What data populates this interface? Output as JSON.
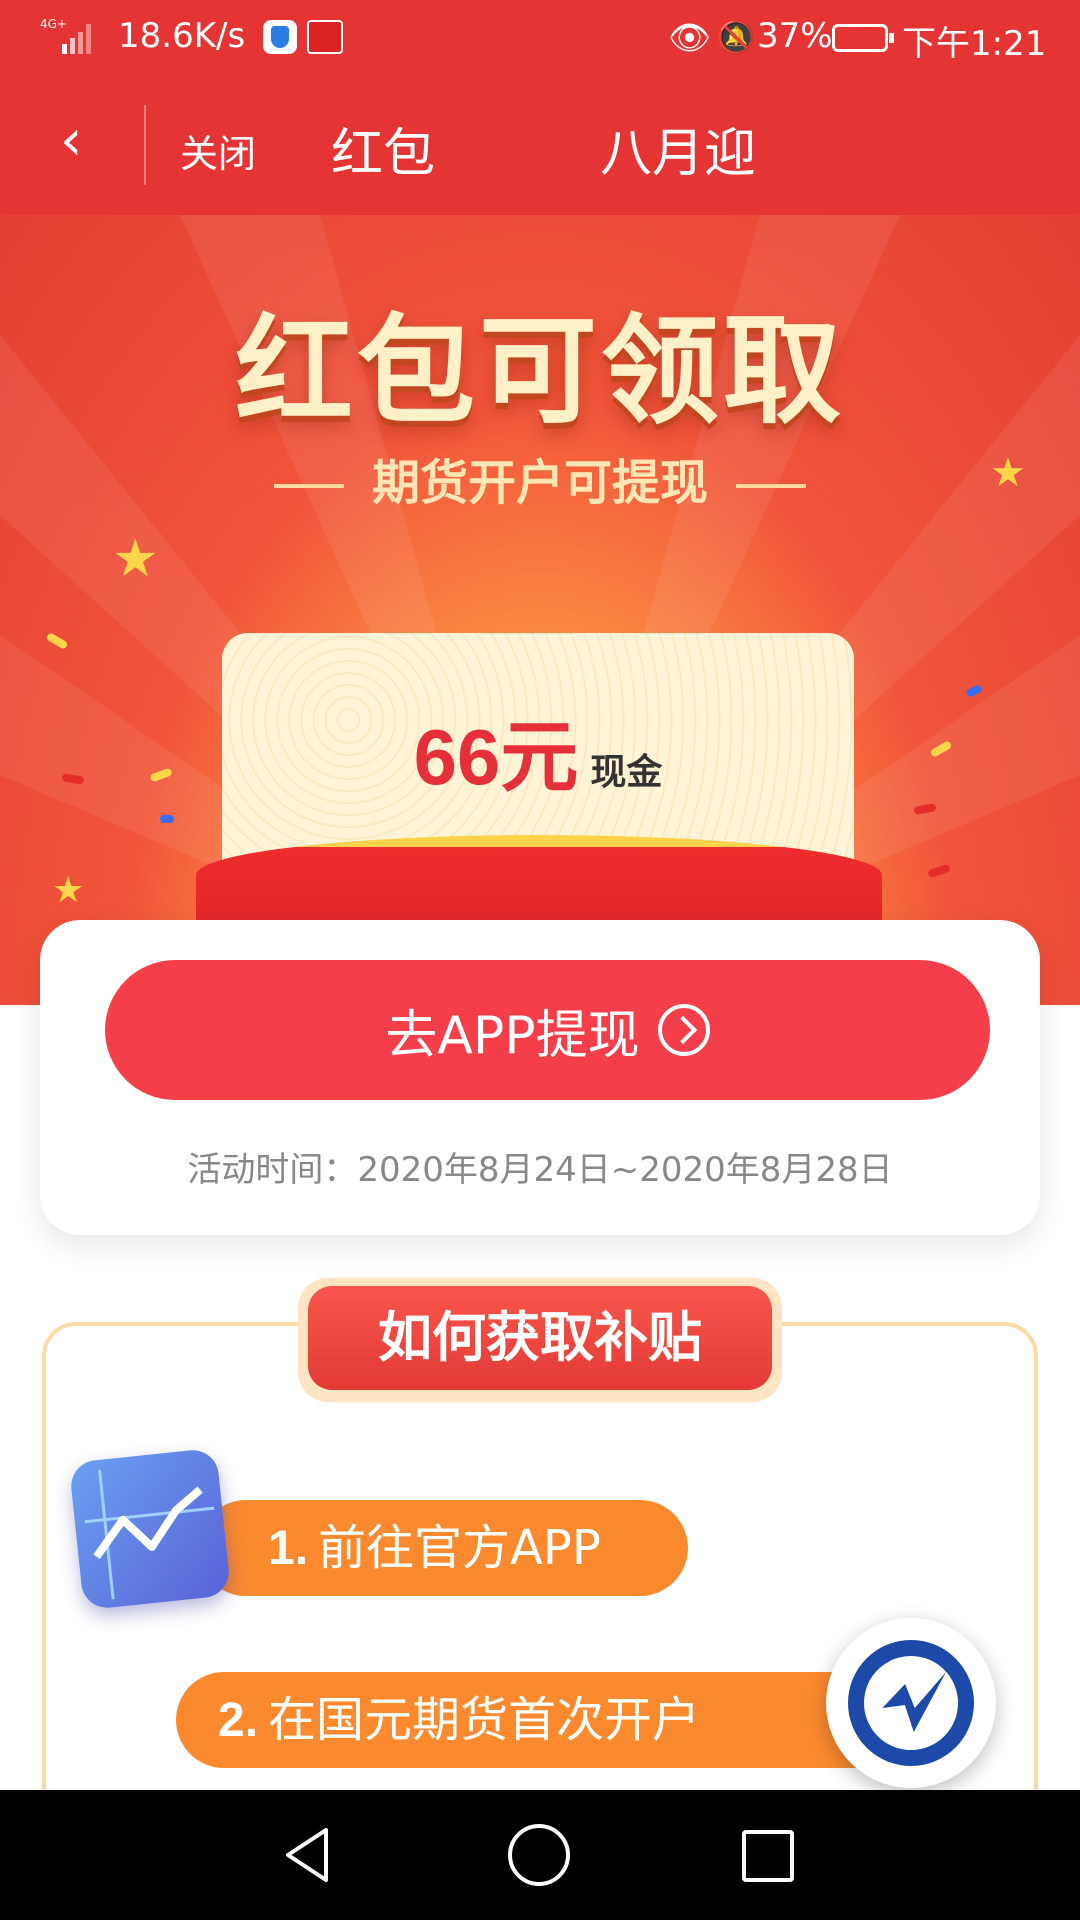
{
  "status_bar": {
    "network": "4G+",
    "speed": "18.6K/s",
    "battery": "37%",
    "time": "下午1:21"
  },
  "nav_bar": {
    "close_label": "关闭",
    "title_partial_left": "红包",
    "title_partial_right": "八月迎"
  },
  "hero": {
    "title": "红包可领取",
    "subtitle": "期货开户可提现",
    "amount": "66元",
    "amount_unit": "现金"
  },
  "action": {
    "cta_label": "去APP提现",
    "date_label": "活动时间：2020年8月24日~2020年8月28日"
  },
  "howto": {
    "title": "如何获取补贴",
    "steps": [
      {
        "num": "1.",
        "text": "前往官方APP"
      },
      {
        "num": "2.",
        "text": "在国元期货首次开户"
      }
    ]
  },
  "colors": {
    "header_red": "#e53434",
    "cta_red": "#f43e4a",
    "step_orange": "#fb8a2f",
    "amount_red": "#e5303a"
  },
  "icons": [
    "signal-icon",
    "shield-icon",
    "eye-icon",
    "mute-icon",
    "battery-icon",
    "back-arrow-icon",
    "chevron-right-circle-icon",
    "chart-app-icon",
    "brand-logo-icon",
    "nav-back-icon",
    "nav-home-icon",
    "nav-recent-icon"
  ]
}
